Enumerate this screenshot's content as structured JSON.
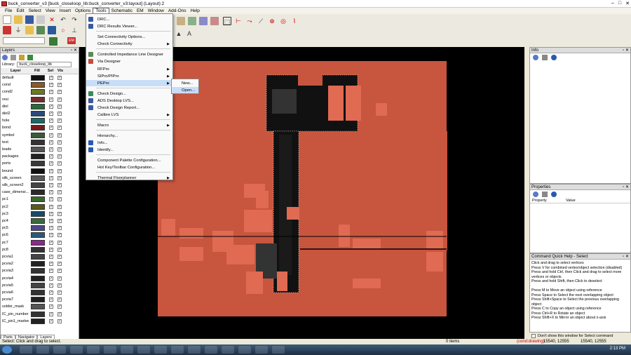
{
  "window": {
    "title": "buck_converter_v3 [buck_closeloop_lib:buck_converter_v3:layout] (Layout):2",
    "controls": [
      "–",
      "□",
      "✕"
    ]
  },
  "menubar": [
    "File",
    "Edit",
    "Select",
    "View",
    "Insert",
    "Options",
    "Tools",
    "Schematic",
    "EM",
    "Window",
    "Add-Ons",
    "Help"
  ],
  "tools_menu": [
    {
      "label": "DRC...",
      "arrow": false
    },
    {
      "label": "DRC Results Viewer...",
      "arrow": false
    },
    {
      "label": "Set Connectivity Options...",
      "arrow": false
    },
    {
      "label": "Check Connectivity",
      "arrow": true
    },
    {
      "label": "Controlled Impedance Line Designer",
      "arrow": false
    },
    {
      "label": "Via Designer",
      "arrow": false
    },
    {
      "label": "RFPro",
      "arrow": true
    },
    {
      "label": "SIPro/PIPro",
      "arrow": true
    },
    {
      "label": "PEPro",
      "arrow": true
    },
    {
      "label": "Check Design...",
      "arrow": false
    },
    {
      "label": "ADS Desktop LVS...",
      "arrow": false
    },
    {
      "label": "Check Design Report...",
      "arrow": false
    },
    {
      "label": "Calibre LVS",
      "arrow": true
    },
    {
      "label": "Macro",
      "arrow": true
    },
    {
      "label": "Hierarchy...",
      "arrow": false
    },
    {
      "label": "Info...",
      "arrow": false
    },
    {
      "label": "Identify...",
      "arrow": false
    },
    {
      "label": "Component Palette Configuration...",
      "arrow": false
    },
    {
      "label": "Hot Key/Toolbar Configuration...",
      "arrow": false
    },
    {
      "label": "Thermal Floorplanner",
      "arrow": true
    }
  ],
  "pepro_submenu": [
    "New...",
    "Open..."
  ],
  "layers": {
    "title": "Layers",
    "library_label": "Library:",
    "library_value": "buck_closeloop_lib",
    "headers": {
      "layer": "Layer",
      "fill": "Fill",
      "sel": "Sel",
      "vis": "Vis"
    },
    "rows": [
      {
        "name": "default",
        "color": "#111111"
      },
      {
        "name": "cond",
        "color": "#8a5a2a"
      },
      {
        "name": "cond2",
        "color": "#6a7a20"
      },
      {
        "name": "resi",
        "color": "#7a2a2a"
      },
      {
        "name": "diel",
        "color": "#2a6a3a"
      },
      {
        "name": "diel2",
        "color": "#2a4a7a"
      },
      {
        "name": "hole",
        "color": "#1a6a6a"
      },
      {
        "name": "bond",
        "color": "#7a1a1a"
      },
      {
        "name": "symbol",
        "color": "#3a5a3a"
      },
      {
        "name": "text",
        "color": "#333333"
      },
      {
        "name": "leads",
        "color": "#555555"
      },
      {
        "name": "packages",
        "color": "#222222"
      },
      {
        "name": "ports",
        "color": "#3a3a3a"
      },
      {
        "name": "bound",
        "color": "#111111"
      },
      {
        "name": "silk_screen",
        "color": "#5a5a5a"
      },
      {
        "name": "silk_screen2",
        "color": "#444444"
      },
      {
        "name": "case_dimensi...",
        "color": "#2a2a2a"
      },
      {
        "name": "pc1",
        "color": "#3a6a2a"
      },
      {
        "name": "pc2",
        "color": "#5a5a1a"
      },
      {
        "name": "pc3",
        "color": "#1a4a6a"
      },
      {
        "name": "pc4",
        "color": "#3a6a3a"
      },
      {
        "name": "pc5",
        "color": "#4a4a8a"
      },
      {
        "name": "pc6",
        "color": "#2a5a7a"
      },
      {
        "name": "pc7",
        "color": "#8a2a8a"
      },
      {
        "name": "pc8",
        "color": "#333333"
      },
      {
        "name": "pcvia1",
        "color": "#444444"
      },
      {
        "name": "pcvia2",
        "color": "#222222"
      },
      {
        "name": "pcvia3",
        "color": "#333333"
      },
      {
        "name": "pcvia4",
        "color": "#222222"
      },
      {
        "name": "pcvia5",
        "color": "#444444"
      },
      {
        "name": "pcvia6",
        "color": "#333333"
      },
      {
        "name": "pcvia7",
        "color": "#222222"
      },
      {
        "name": "solder_mask",
        "color": "#555555"
      },
      {
        "name": "IC_pin_number",
        "color": "#333333"
      },
      {
        "name": "IC_pin1_marker",
        "color": "#222222"
      }
    ],
    "tabs": [
      "Parts",
      "Navigator",
      "Layers"
    ]
  },
  "info_panel": {
    "title": "Info"
  },
  "properties_panel": {
    "title": "Properties",
    "col_property": "Property",
    "col_value": "Value"
  },
  "quick_help": {
    "title": "Command Quick Help - Select",
    "lines": [
      "Click and drag to select vertices",
      "Press V for combined vertex/object selection (disabled)",
      "Press and hold Ctrl, then Click and drag to select more",
      "vertices or objects",
      "Press and hold Shift, then Click to deselect",
      "",
      "Press M to Move an object using reference",
      "Press Space to Select the next overlapping object",
      "Press Shift+Space to Select the previous overlapping",
      "object",
      "Press C to Copy an object using reference",
      "Press Ctrl+R to Rotate an object",
      "Press Shift+X to Mirror an object about x-axis"
    ],
    "dont_show": "Don't show this window for Select command"
  },
  "status": {
    "message": "Select: Click and drag to select.",
    "items": "0 items",
    "mode": "(cond:drawing)",
    "coord1": "15540, 12555",
    "coord2": "15540, 12555"
  },
  "taskbar": {
    "time": "2:13 PM"
  },
  "colors": {
    "copper": "#c8553e",
    "pad": "#e06a52",
    "canvas": "#000000"
  }
}
